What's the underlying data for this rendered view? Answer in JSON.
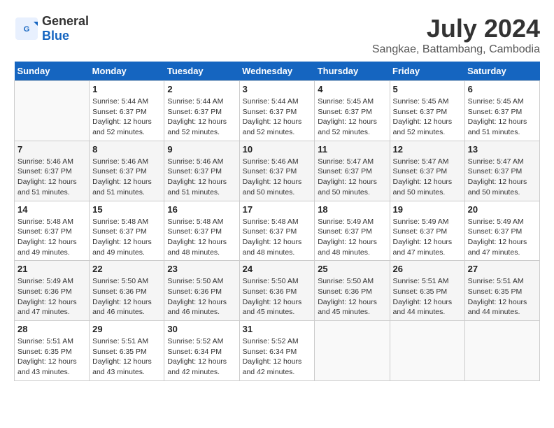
{
  "header": {
    "logo_general": "General",
    "logo_blue": "Blue",
    "month_title": "July 2024",
    "location": "Sangkae, Battambang, Cambodia"
  },
  "weekdays": [
    "Sunday",
    "Monday",
    "Tuesday",
    "Wednesday",
    "Thursday",
    "Friday",
    "Saturday"
  ],
  "weeks": [
    [
      {
        "day": "",
        "sunrise": "",
        "sunset": "",
        "daylight": ""
      },
      {
        "day": "1",
        "sunrise": "Sunrise: 5:44 AM",
        "sunset": "Sunset: 6:37 PM",
        "daylight": "Daylight: 12 hours and 52 minutes."
      },
      {
        "day": "2",
        "sunrise": "Sunrise: 5:44 AM",
        "sunset": "Sunset: 6:37 PM",
        "daylight": "Daylight: 12 hours and 52 minutes."
      },
      {
        "day": "3",
        "sunrise": "Sunrise: 5:44 AM",
        "sunset": "Sunset: 6:37 PM",
        "daylight": "Daylight: 12 hours and 52 minutes."
      },
      {
        "day": "4",
        "sunrise": "Sunrise: 5:45 AM",
        "sunset": "Sunset: 6:37 PM",
        "daylight": "Daylight: 12 hours and 52 minutes."
      },
      {
        "day": "5",
        "sunrise": "Sunrise: 5:45 AM",
        "sunset": "Sunset: 6:37 PM",
        "daylight": "Daylight: 12 hours and 52 minutes."
      },
      {
        "day": "6",
        "sunrise": "Sunrise: 5:45 AM",
        "sunset": "Sunset: 6:37 PM",
        "daylight": "Daylight: 12 hours and 51 minutes."
      }
    ],
    [
      {
        "day": "7",
        "sunrise": "Sunrise: 5:46 AM",
        "sunset": "Sunset: 6:37 PM",
        "daylight": "Daylight: 12 hours and 51 minutes."
      },
      {
        "day": "8",
        "sunrise": "Sunrise: 5:46 AM",
        "sunset": "Sunset: 6:37 PM",
        "daylight": "Daylight: 12 hours and 51 minutes."
      },
      {
        "day": "9",
        "sunrise": "Sunrise: 5:46 AM",
        "sunset": "Sunset: 6:37 PM",
        "daylight": "Daylight: 12 hours and 51 minutes."
      },
      {
        "day": "10",
        "sunrise": "Sunrise: 5:46 AM",
        "sunset": "Sunset: 6:37 PM",
        "daylight": "Daylight: 12 hours and 50 minutes."
      },
      {
        "day": "11",
        "sunrise": "Sunrise: 5:47 AM",
        "sunset": "Sunset: 6:37 PM",
        "daylight": "Daylight: 12 hours and 50 minutes."
      },
      {
        "day": "12",
        "sunrise": "Sunrise: 5:47 AM",
        "sunset": "Sunset: 6:37 PM",
        "daylight": "Daylight: 12 hours and 50 minutes."
      },
      {
        "day": "13",
        "sunrise": "Sunrise: 5:47 AM",
        "sunset": "Sunset: 6:37 PM",
        "daylight": "Daylight: 12 hours and 50 minutes."
      }
    ],
    [
      {
        "day": "14",
        "sunrise": "Sunrise: 5:48 AM",
        "sunset": "Sunset: 6:37 PM",
        "daylight": "Daylight: 12 hours and 49 minutes."
      },
      {
        "day": "15",
        "sunrise": "Sunrise: 5:48 AM",
        "sunset": "Sunset: 6:37 PM",
        "daylight": "Daylight: 12 hours and 49 minutes."
      },
      {
        "day": "16",
        "sunrise": "Sunrise: 5:48 AM",
        "sunset": "Sunset: 6:37 PM",
        "daylight": "Daylight: 12 hours and 48 minutes."
      },
      {
        "day": "17",
        "sunrise": "Sunrise: 5:48 AM",
        "sunset": "Sunset: 6:37 PM",
        "daylight": "Daylight: 12 hours and 48 minutes."
      },
      {
        "day": "18",
        "sunrise": "Sunrise: 5:49 AM",
        "sunset": "Sunset: 6:37 PM",
        "daylight": "Daylight: 12 hours and 48 minutes."
      },
      {
        "day": "19",
        "sunrise": "Sunrise: 5:49 AM",
        "sunset": "Sunset: 6:37 PM",
        "daylight": "Daylight: 12 hours and 47 minutes."
      },
      {
        "day": "20",
        "sunrise": "Sunrise: 5:49 AM",
        "sunset": "Sunset: 6:37 PM",
        "daylight": "Daylight: 12 hours and 47 minutes."
      }
    ],
    [
      {
        "day": "21",
        "sunrise": "Sunrise: 5:49 AM",
        "sunset": "Sunset: 6:36 PM",
        "daylight": "Daylight: 12 hours and 47 minutes."
      },
      {
        "day": "22",
        "sunrise": "Sunrise: 5:50 AM",
        "sunset": "Sunset: 6:36 PM",
        "daylight": "Daylight: 12 hours and 46 minutes."
      },
      {
        "day": "23",
        "sunrise": "Sunrise: 5:50 AM",
        "sunset": "Sunset: 6:36 PM",
        "daylight": "Daylight: 12 hours and 46 minutes."
      },
      {
        "day": "24",
        "sunrise": "Sunrise: 5:50 AM",
        "sunset": "Sunset: 6:36 PM",
        "daylight": "Daylight: 12 hours and 45 minutes."
      },
      {
        "day": "25",
        "sunrise": "Sunrise: 5:50 AM",
        "sunset": "Sunset: 6:36 PM",
        "daylight": "Daylight: 12 hours and 45 minutes."
      },
      {
        "day": "26",
        "sunrise": "Sunrise: 5:51 AM",
        "sunset": "Sunset: 6:35 PM",
        "daylight": "Daylight: 12 hours and 44 minutes."
      },
      {
        "day": "27",
        "sunrise": "Sunrise: 5:51 AM",
        "sunset": "Sunset: 6:35 PM",
        "daylight": "Daylight: 12 hours and 44 minutes."
      }
    ],
    [
      {
        "day": "28",
        "sunrise": "Sunrise: 5:51 AM",
        "sunset": "Sunset: 6:35 PM",
        "daylight": "Daylight: 12 hours and 43 minutes."
      },
      {
        "day": "29",
        "sunrise": "Sunrise: 5:51 AM",
        "sunset": "Sunset: 6:35 PM",
        "daylight": "Daylight: 12 hours and 43 minutes."
      },
      {
        "day": "30",
        "sunrise": "Sunrise: 5:52 AM",
        "sunset": "Sunset: 6:34 PM",
        "daylight": "Daylight: 12 hours and 42 minutes."
      },
      {
        "day": "31",
        "sunrise": "Sunrise: 5:52 AM",
        "sunset": "Sunset: 6:34 PM",
        "daylight": "Daylight: 12 hours and 42 minutes."
      },
      {
        "day": "",
        "sunrise": "",
        "sunset": "",
        "daylight": ""
      },
      {
        "day": "",
        "sunrise": "",
        "sunset": "",
        "daylight": ""
      },
      {
        "day": "",
        "sunrise": "",
        "sunset": "",
        "daylight": ""
      }
    ]
  ]
}
